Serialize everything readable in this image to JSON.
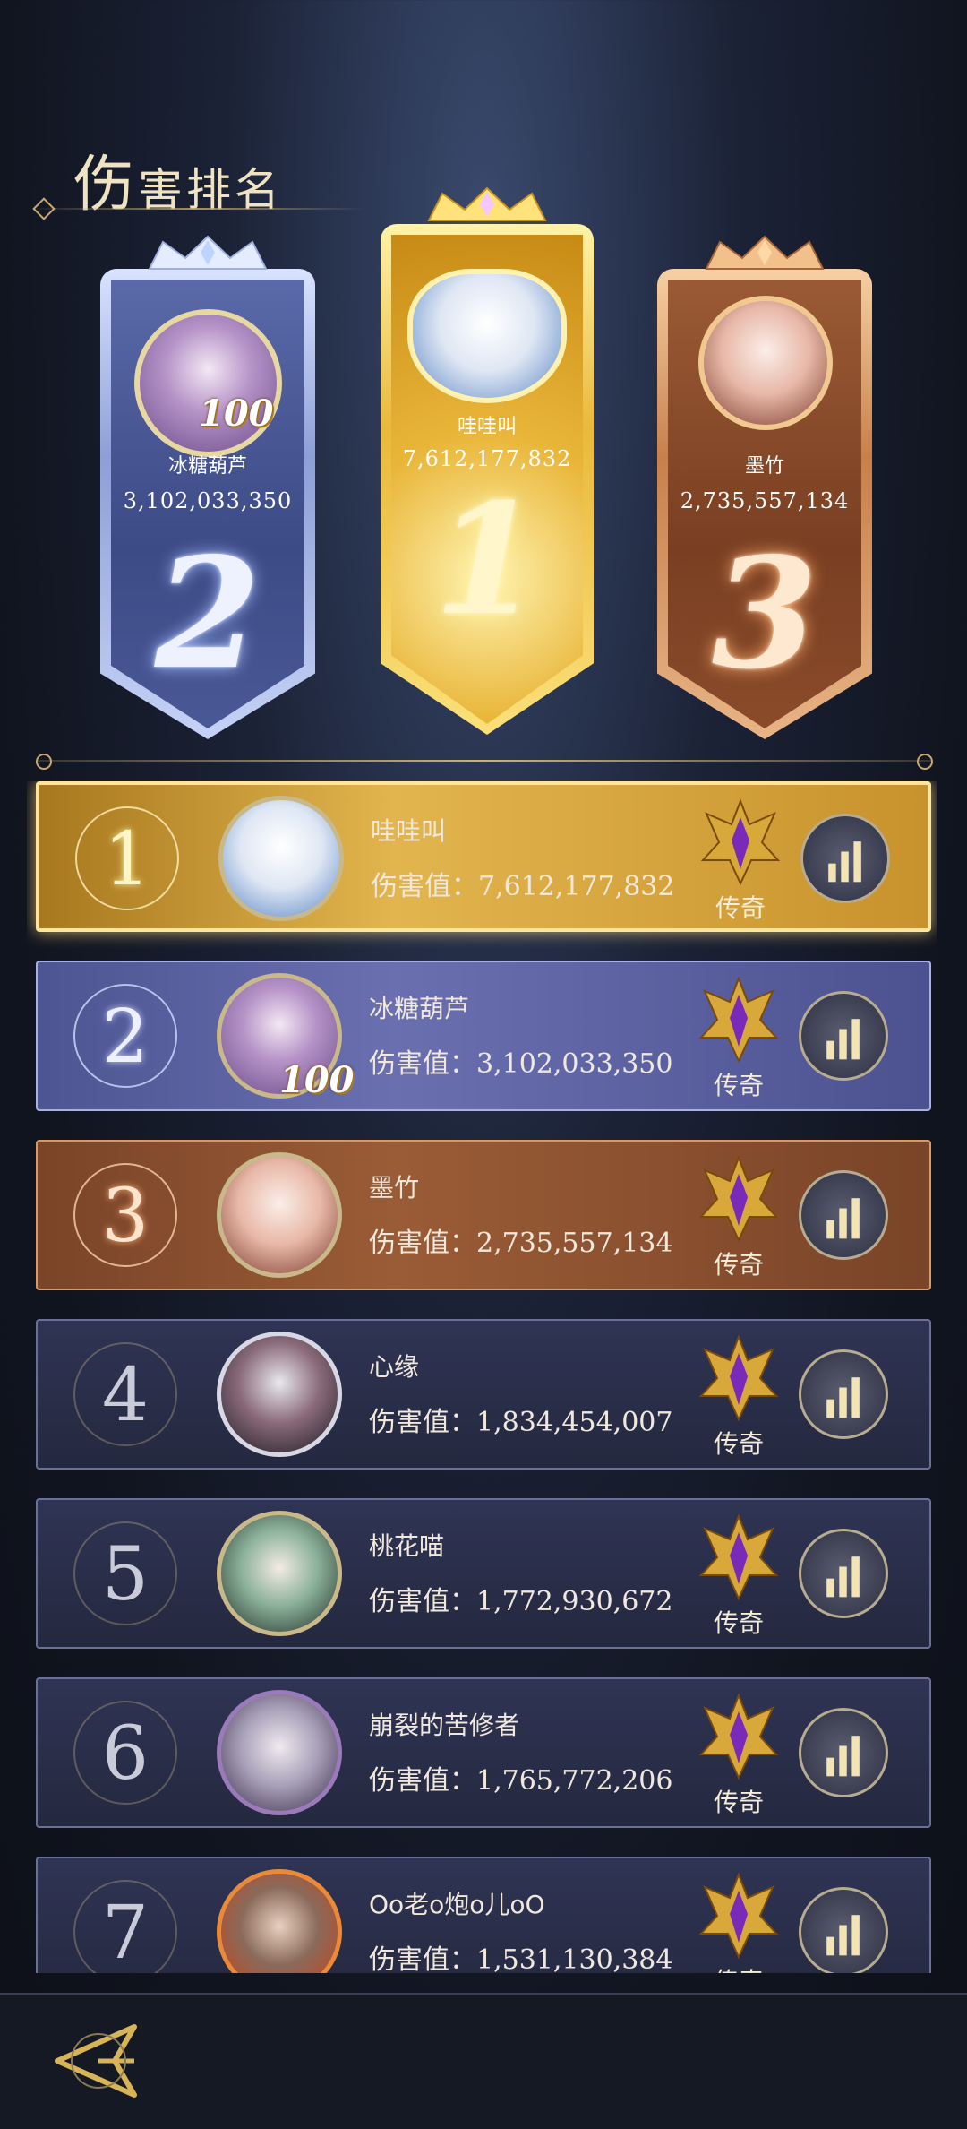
{
  "header": {
    "title_first": "伤",
    "title_rest": "害排名"
  },
  "podium": [
    {
      "rank": "2",
      "name": "冰糖葫芦",
      "score": "3,102,033,350",
      "badge": "100"
    },
    {
      "rank": "1",
      "name": "哇哇叫",
      "score": "7,612,177,832"
    },
    {
      "rank": "3",
      "name": "墨竹",
      "score": "2,735,557,134"
    }
  ],
  "list": {
    "score_label": "伤害值：",
    "rows": [
      {
        "rank": "1",
        "name": "哇哇叫",
        "score": "7,612,177,832",
        "tier": "传奇"
      },
      {
        "rank": "2",
        "name": "冰糖葫芦",
        "score": "3,102,033,350",
        "tier": "传奇",
        "badge": "100"
      },
      {
        "rank": "3",
        "name": "墨竹",
        "score": "2,735,557,134",
        "tier": "传奇"
      },
      {
        "rank": "4",
        "name": "心缘",
        "score": "1,834,454,007",
        "tier": "传奇"
      },
      {
        "rank": "5",
        "name": "桃花喵",
        "score": "1,772,930,672",
        "tier": "传奇"
      },
      {
        "rank": "6",
        "name": "崩裂的苦修者",
        "score": "1,765,772,206",
        "tier": "传奇"
      },
      {
        "rank": "7",
        "name": "Oo老o炮o儿oO",
        "score": "1,531,130,384",
        "tier": "传奇"
      }
    ]
  },
  "icons": {
    "stats": "bar-chart-icon",
    "tier": "legend-emblem-icon",
    "back": "back-arrow-icon"
  }
}
